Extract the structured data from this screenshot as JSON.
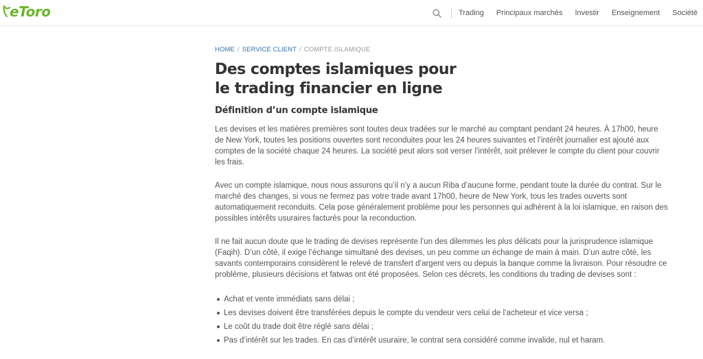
{
  "header": {
    "logo_text": "eToro",
    "nav": {
      "items": [
        {
          "label": "Trading"
        },
        {
          "label": "Principaux marchés"
        },
        {
          "label": "Investir"
        },
        {
          "label": "Enseignement"
        },
        {
          "label": "Société"
        }
      ]
    },
    "search_icon": "search-icon"
  },
  "breadcrumb": {
    "home": "HOME",
    "separator": "/",
    "service": "SERVICE CLIENT",
    "current": "COMPTE ISLAMIQUE"
  },
  "article": {
    "title": "Des comptes islamiques pour le trading financier en ligne",
    "subtitle": "Définition d’un compte islamique",
    "paragraphs": [
      "Les devises et les matières premières sont toutes deux tradées sur le marché au comptant pendant 24 heures. À 17h00, heure de New York, toutes les positions ouvertes sont reconduites pour les 24 heures suivantes et l’intérêt journalier est ajouté aux comptes de la société chaque 24 heures. La société peut alors soit verser l’intérêt, soit prélever le compte du client pour couvrir les frais.",
      "Avec un compte islamique, nous nous assurons qu’il n’y a aucun Riba d’aucune forme, pendant toute la durée du contrat. Sur le marché des changes, si vous ne fermez pas votre trade avant 17h00, heure de New York, tous les trades ouverts sont automatiquement reconduits. Cela pose généralement problème pour les personnes qui adhèrent à la loi islamique, en raison des possibles intérêts usuraires facturés pour la reconduction.",
      "Il ne fait aucun doute que le trading de devises représente l’un des dilemmes les plus délicats pour la jurisprudence islamique (Faqih). D’un côté, il exige l’échange simultané des devises, un peu comme un échange de main à main. D’un autre côté, les savants contemporains considèrent le relevé de transfert d’argent vers ou depuis la banque comme la livraison. Pour résoudre ce problème, plusieurs décisions et fatwas ont été proposées. Selon ces décrets, les conditions du trading de devises sont :"
    ],
    "list": [
      "Achat et vente immédiats sans délai ;",
      "Les devises doivent être transférées depuis le compte du vendeur vers celui de l’acheteur et vice versa ;",
      "Le coût du trade doit être réglé sans délai ;",
      "Pas d’intérêt sur les trades. En cas d’intérêt usuraire, le contrat sera considéré comme invalide, nul et haram."
    ]
  },
  "colors": {
    "brand_green": "#6cb52d",
    "link_blue": "#2f6fb0",
    "text": "#555555",
    "heading": "#333333"
  }
}
